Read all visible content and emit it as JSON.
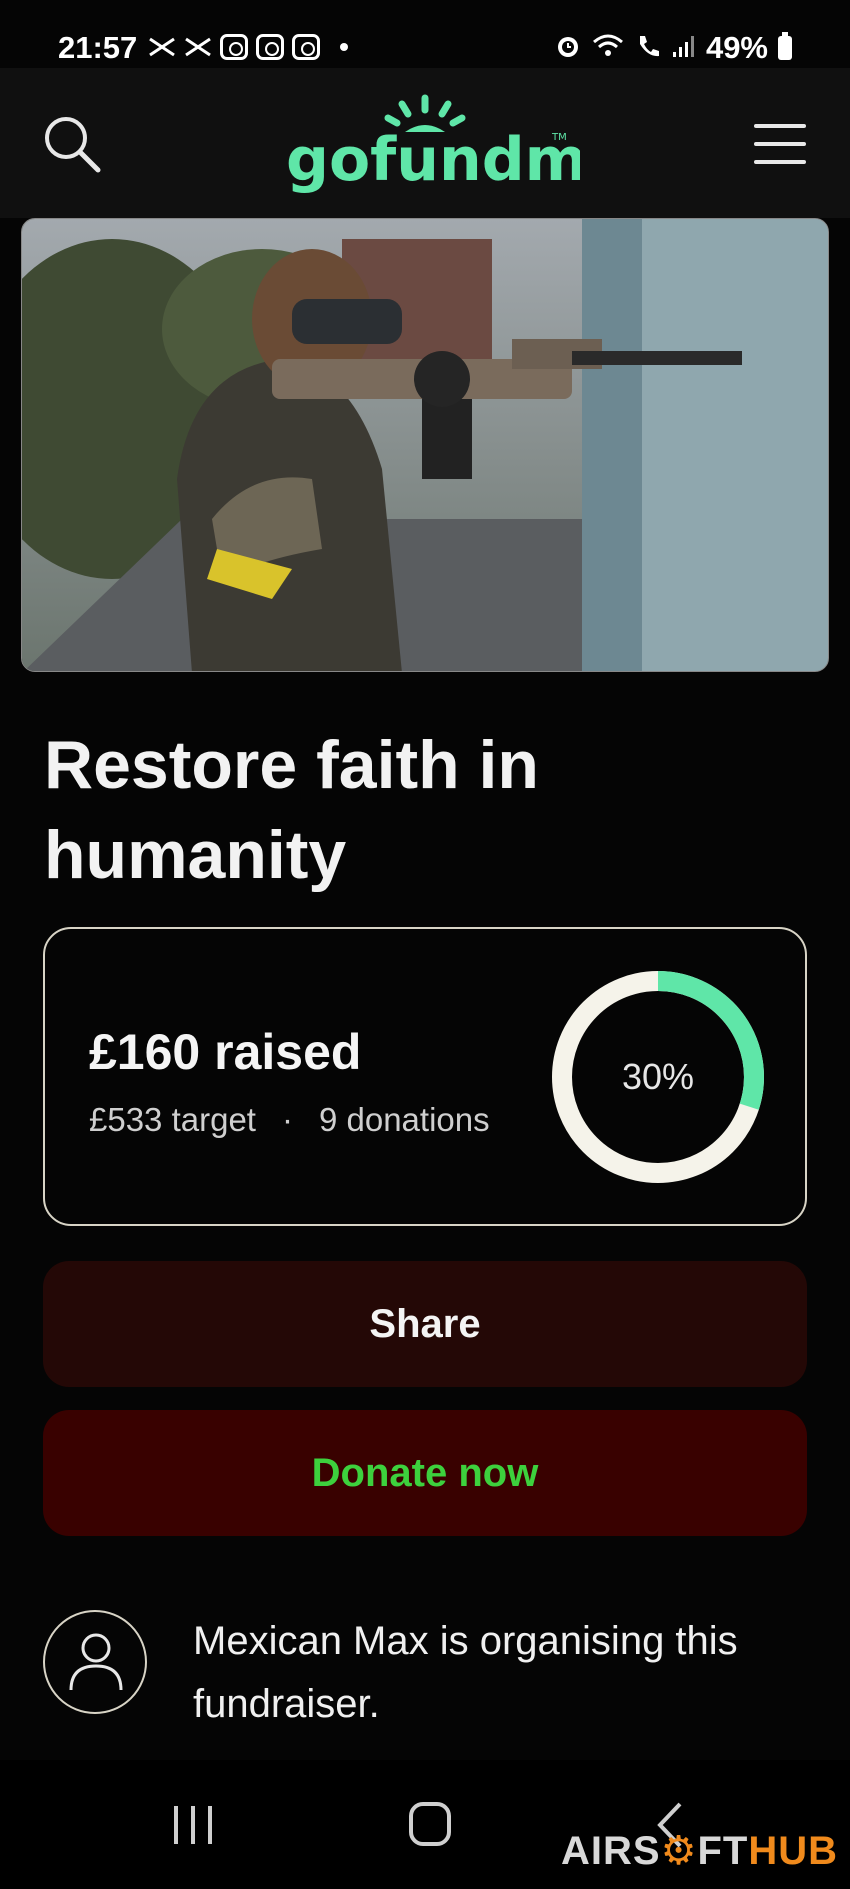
{
  "status_bar": {
    "time": "21:57",
    "battery": "49%",
    "icons": [
      "halifax-icon",
      "halifax-icon",
      "instagram-icon",
      "instagram-icon",
      "instagram-icon",
      "alarm-icon",
      "wifi-icon",
      "wifi-calling-icon",
      "signal-icon",
      "battery-icon"
    ]
  },
  "header": {
    "logo_text": "gofundme",
    "trademark": "TM",
    "brand_color": "#5fe6a8"
  },
  "hero": {
    "image_description_icon": "hero-photo"
  },
  "fundraiser": {
    "title": "Restore faith in humanity",
    "raised": "£160 raised",
    "target": "£533 target",
    "separator": "·",
    "donations": "9 donations",
    "progress_label": "30%",
    "progress_fraction": 0.3,
    "progress_color": "#5fe6a8",
    "ring_track_color": "#f5f3ea"
  },
  "actions": {
    "share_label": "Share",
    "donate_label": "Donate now"
  },
  "organiser": {
    "text": "Mexican Max is organising this fundraiser."
  },
  "watermark": {
    "part1": "AIRS",
    "part2": "FT",
    "part3": "HUB"
  }
}
